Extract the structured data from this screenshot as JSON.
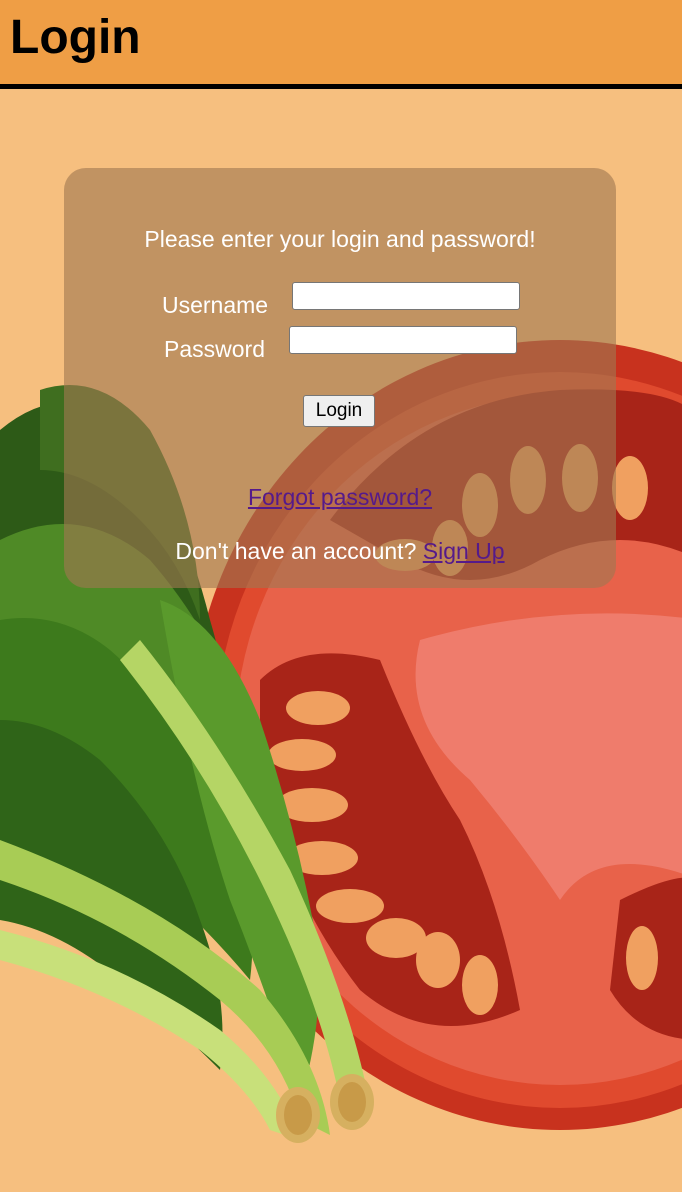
{
  "header": {
    "title": "Login"
  },
  "form": {
    "prompt": "Please enter your login and password!",
    "username_label": "Username",
    "password_label": "Password",
    "username_value": "",
    "password_value": "",
    "login_button": "Login",
    "forgot_link": "Forgot password?",
    "signup_text": "Don't have an account?",
    "signup_link": "Sign Up"
  },
  "icons": {
    "background": "tomato-and-greens-illustration"
  },
  "colors": {
    "header_bg": "#ef9e45",
    "page_bg": "#f6bf7f",
    "link": "#551a8b"
  }
}
